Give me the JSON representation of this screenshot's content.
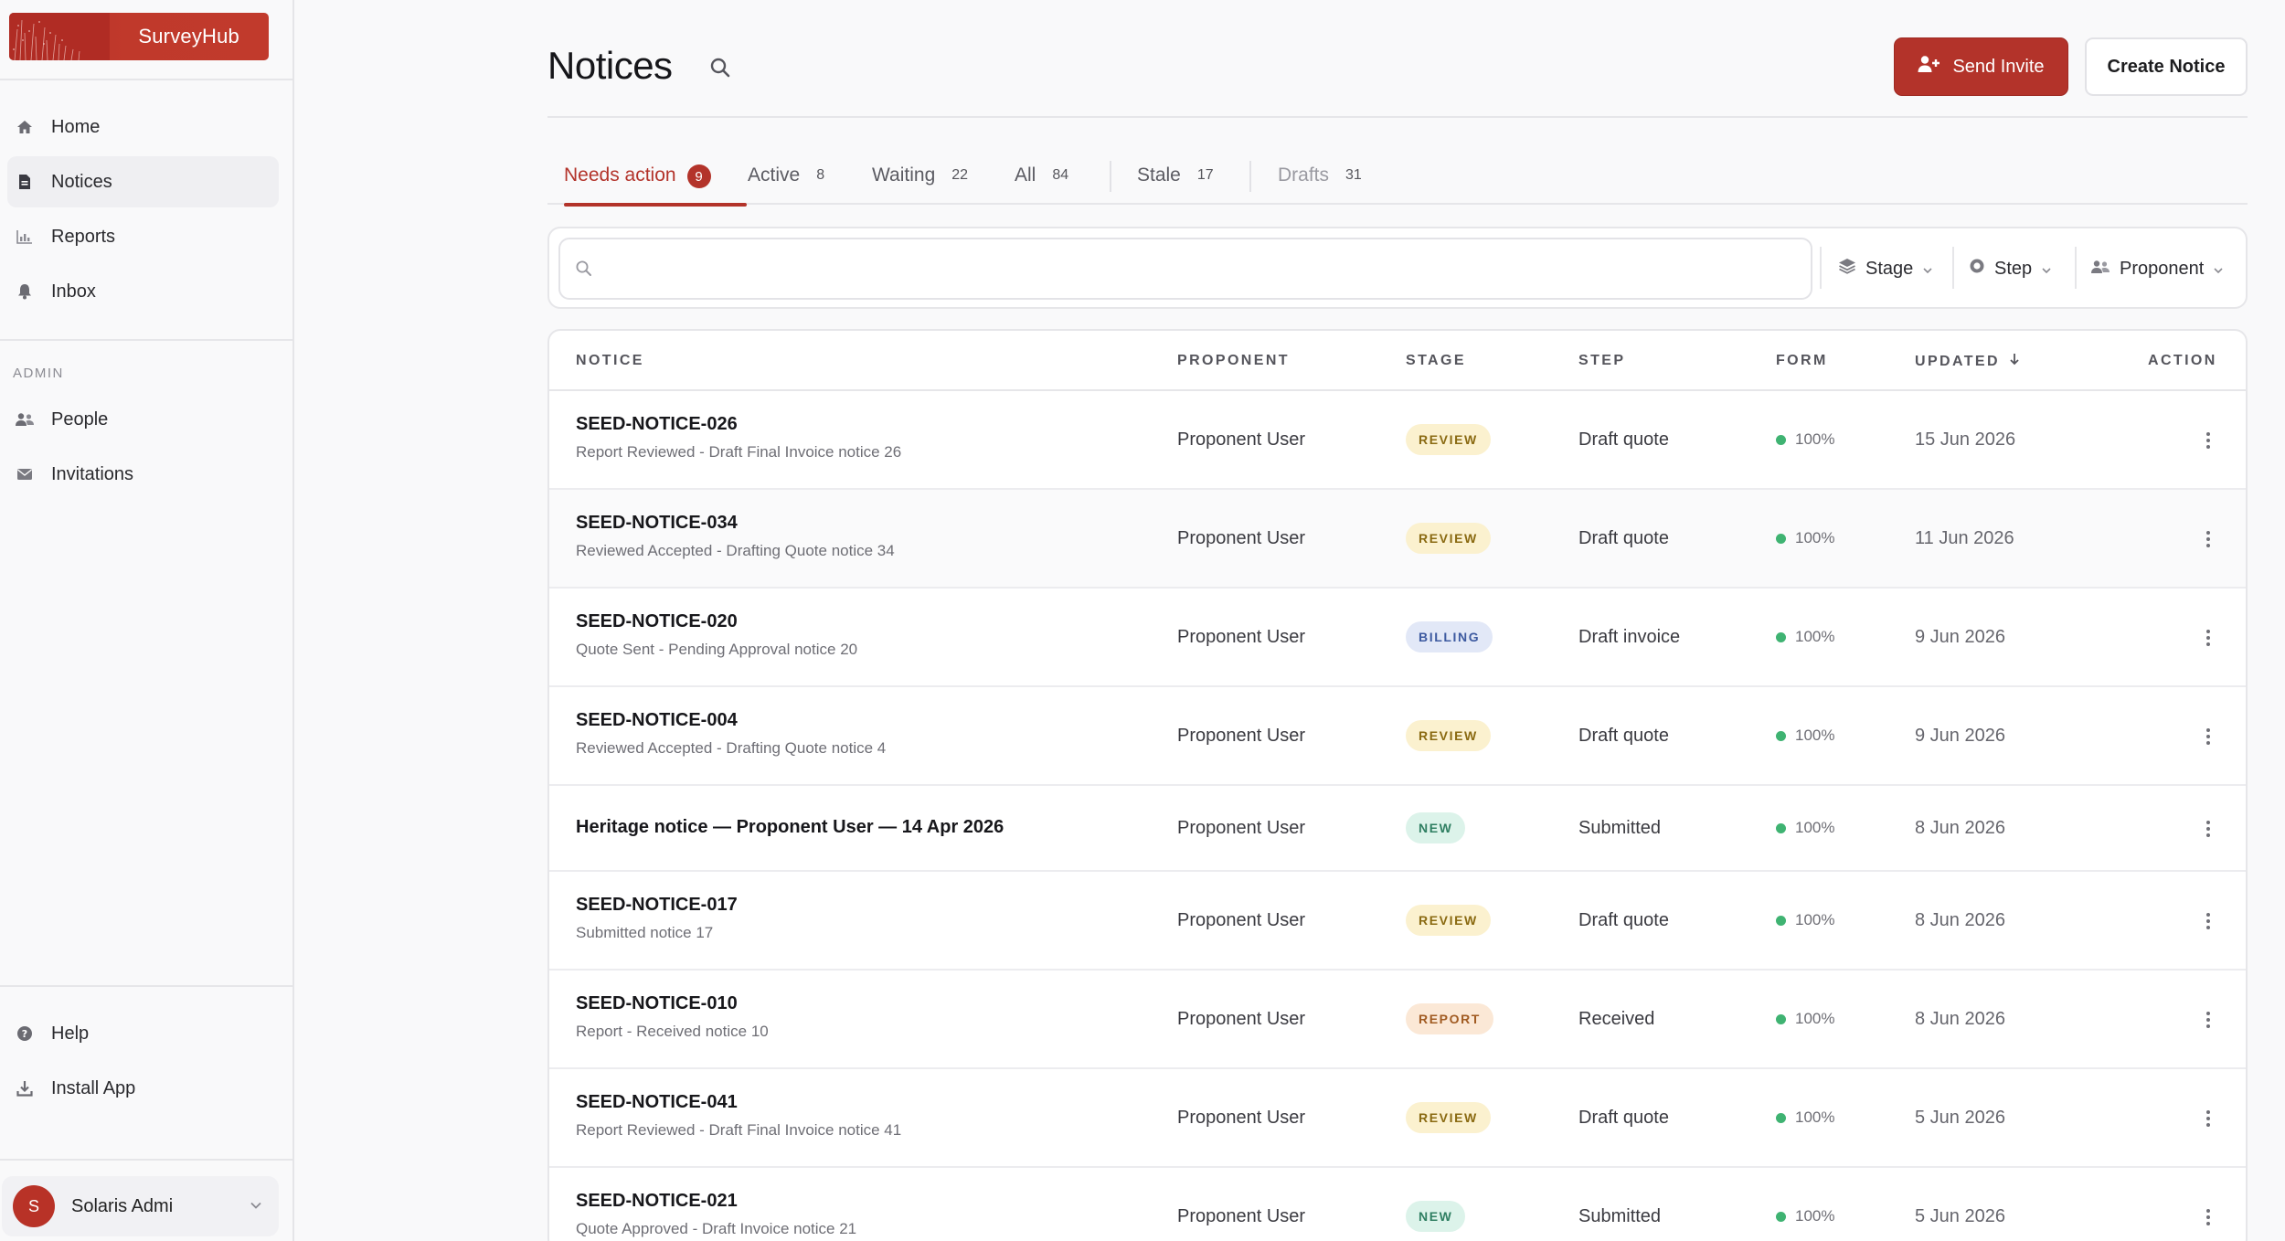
{
  "app": {
    "name": "SurveyHub"
  },
  "sidebar": {
    "primary": [
      {
        "label": "Home",
        "icon": "home-icon"
      },
      {
        "label": "Notices",
        "icon": "document-icon",
        "active": true
      },
      {
        "label": "Reports",
        "icon": "bar-chart-icon"
      },
      {
        "label": "Inbox",
        "icon": "bell-icon"
      }
    ],
    "admin_heading": "ADMIN",
    "admin": [
      {
        "label": "People",
        "icon": "people-icon"
      },
      {
        "label": "Invitations",
        "icon": "envelope-icon"
      }
    ],
    "footer": [
      {
        "label": "Help",
        "icon": "help-icon"
      },
      {
        "label": "Install App",
        "icon": "download-icon"
      }
    ],
    "user": {
      "initial": "S",
      "name": "Solaris Admi"
    }
  },
  "header": {
    "title": "Notices",
    "send_invite": "Send Invite",
    "create_notice": "Create Notice"
  },
  "tabs": [
    {
      "label": "Needs action",
      "count": "9"
    },
    {
      "label": "Active",
      "count": "8"
    },
    {
      "label": "Waiting",
      "count": "22"
    },
    {
      "label": "All",
      "count": "84"
    },
    {
      "label": "Stale",
      "count": "17"
    },
    {
      "label": "Drafts",
      "count": "31"
    }
  ],
  "filters": {
    "search_placeholder": "",
    "stage": "Stage",
    "step": "Step",
    "proponent": "Proponent"
  },
  "table": {
    "columns": {
      "notice": "NOTICE",
      "proponent": "PROPONENT",
      "stage": "STAGE",
      "step": "STEP",
      "form": "FORM",
      "updated": "UPDATED",
      "action": "ACTION"
    },
    "rows": [
      {
        "id": "SEED-NOTICE-026",
        "sub": "Report Reviewed - Draft Final Invoice notice 26",
        "proponent": "Proponent User",
        "stage": "REVIEW",
        "step": "Draft quote",
        "form": "100%",
        "updated": "15 Jun 2026"
      },
      {
        "id": "SEED-NOTICE-034",
        "sub": "Reviewed Accepted - Drafting Quote notice 34",
        "proponent": "Proponent User",
        "stage": "REVIEW",
        "step": "Draft quote",
        "form": "100%",
        "updated": "11 Jun 2026"
      },
      {
        "id": "SEED-NOTICE-020",
        "sub": "Quote Sent - Pending Approval notice 20",
        "proponent": "Proponent User",
        "stage": "BILLING",
        "step": "Draft invoice",
        "form": "100%",
        "updated": "9 Jun 2026"
      },
      {
        "id": "SEED-NOTICE-004",
        "sub": "Reviewed Accepted - Drafting Quote notice 4",
        "proponent": "Proponent User",
        "stage": "REVIEW",
        "step": "Draft quote",
        "form": "100%",
        "updated": "9 Jun 2026"
      },
      {
        "id": "Heritage notice — Proponent User — 14 Apr 2026",
        "sub": "",
        "proponent": "Proponent User",
        "stage": "NEW",
        "step": "Submitted",
        "form": "100%",
        "updated": "8 Jun 2026"
      },
      {
        "id": "SEED-NOTICE-017",
        "sub": "Submitted notice 17",
        "proponent": "Proponent User",
        "stage": "REVIEW",
        "step": "Draft quote",
        "form": "100%",
        "updated": "8 Jun 2026"
      },
      {
        "id": "SEED-NOTICE-010",
        "sub": "Report - Received notice 10",
        "proponent": "Proponent User",
        "stage": "REPORT",
        "step": "Received",
        "form": "100%",
        "updated": "8 Jun 2026"
      },
      {
        "id": "SEED-NOTICE-041",
        "sub": "Report Reviewed - Draft Final Invoice notice 41",
        "proponent": "Proponent User",
        "stage": "REVIEW",
        "step": "Draft quote",
        "form": "100%",
        "updated": "5 Jun 2026"
      },
      {
        "id": "SEED-NOTICE-021",
        "sub": "Quote Approved - Draft Invoice notice 21",
        "proponent": "Proponent User",
        "stage": "NEW",
        "step": "Submitted",
        "form": "100%",
        "updated": "5 Jun 2026"
      }
    ]
  }
}
